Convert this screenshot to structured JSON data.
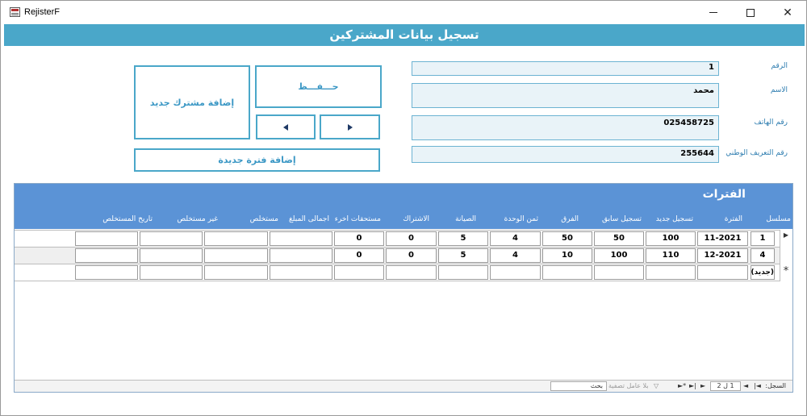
{
  "window": {
    "title": "RejisterF"
  },
  "header": {
    "title": "تسجيل بيانات المشتركين"
  },
  "form": {
    "fields": [
      {
        "label": "الرقم",
        "value": "1"
      },
      {
        "label": "الاسم",
        "value": "محمد"
      },
      {
        "label": "رقم الهاتف",
        "value": "025458725"
      },
      {
        "label": "رقم التعريف الوطني",
        "value": "255644"
      }
    ],
    "buttons": {
      "save": "حـــفـــظ",
      "add_subscriber": "إضافة مشترك جديد",
      "add_period": "إضافة فترة جديدة"
    }
  },
  "subform": {
    "title": "الفترات",
    "columns": [
      "مسلسل",
      "الفترة",
      "تسجيل جديد",
      "تسجيل سابق",
      "الفرق",
      "ثمن الوحدة",
      "الصيانة",
      "الاشتراك",
      "مستحقات اخرء",
      "اجمالى المبلغ",
      "مستخلص",
      "غير مستخلص",
      "تاريخ المستخلص"
    ],
    "rows": [
      [
        "1",
        "11-2021",
        "100",
        "50",
        "50",
        "4",
        "5",
        "0",
        "0",
        "",
        "",
        "",
        ""
      ],
      [
        "4",
        "12-2021",
        "110",
        "100",
        "10",
        "4",
        "5",
        "0",
        "0",
        "",
        "",
        "",
        ""
      ]
    ],
    "new_row_label": "(جديد)",
    "new_row_marker": "*",
    "current_row_marker": "▶"
  },
  "navigator": {
    "label": "السجل:",
    "position": "1 ل 2",
    "filter": "بلا عامل تصفية",
    "search": "بحث"
  }
}
